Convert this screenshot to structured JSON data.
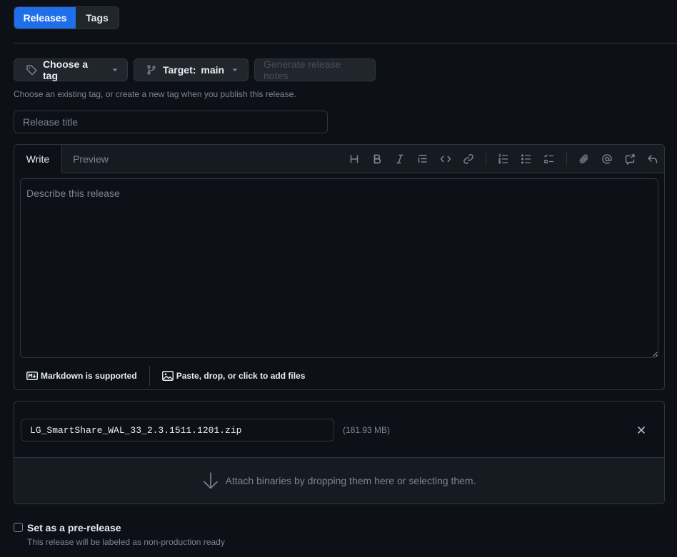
{
  "top_tabs": [
    {
      "label": "Releases",
      "active": true
    },
    {
      "label": "Tags",
      "active": false
    }
  ],
  "tag_selector": {
    "label": "Choose a tag"
  },
  "target_selector": {
    "prefix": "Target:",
    "branch": "main"
  },
  "generate_notes": {
    "label": "Generate release notes",
    "disabled": true
  },
  "tag_hint": "Choose an existing tag, or create a new tag when you publish this release.",
  "release_title": {
    "placeholder": "Release title",
    "value": ""
  },
  "editor": {
    "tabs": [
      {
        "label": "Write",
        "active": true
      },
      {
        "label": "Preview",
        "active": false
      }
    ],
    "toolbar_icons": [
      "heading-icon",
      "bold-icon",
      "italic-icon",
      "quote-icon",
      "code-icon",
      "link-icon",
      "ordered-list-icon",
      "unordered-list-icon",
      "task-list-icon",
      "attach-icon",
      "mention-icon",
      "cross-reference-icon",
      "reply-icon"
    ],
    "heading_glyph": "H",
    "placeholder": "Describe this release",
    "footer_markdown": "Markdown is supported",
    "footer_files": "Paste, drop, or click to add files"
  },
  "attachment": {
    "filename": "LG_SmartShare_WAL_33_2.3.1511.1201.zip",
    "size": "(181.93 MB)",
    "dropzone_text": "Attach binaries by dropping them here or selecting them."
  },
  "prerelease": {
    "label": "Set as a pre-release",
    "note": "This release will be labeled as non-production ready",
    "checked": false
  },
  "colors": {
    "background": "#0d1117",
    "accent": "#1f6feb",
    "border": "#30363d",
    "muted_text": "#7d8590"
  }
}
